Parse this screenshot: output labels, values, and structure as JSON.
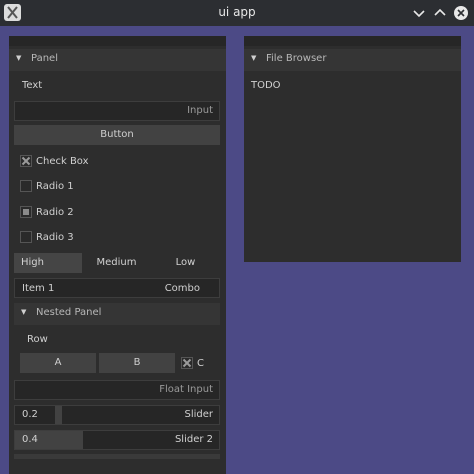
{
  "window": {
    "title": "ui app",
    "icon": "x-app-icon"
  },
  "window_controls": [
    "minimize",
    "maximize",
    "close"
  ],
  "panel": {
    "title": "Panel",
    "text": "Text",
    "input": {
      "value": "",
      "placeholder": "Input"
    },
    "button_label": "Button",
    "checkbox": {
      "label": "Check Box",
      "checked": true
    },
    "radios": [
      {
        "label": "Radio 1",
        "selected": false
      },
      {
        "label": "Radio 2",
        "selected": true
      },
      {
        "label": "Radio 3",
        "selected": false
      }
    ],
    "segmented": {
      "options": [
        "High",
        "Medium",
        "Low"
      ],
      "selected": "High"
    },
    "combo": {
      "selected": "Item 1",
      "label": "Combo"
    },
    "nested_panel": {
      "title": "Nested Panel",
      "row_label": "Row",
      "buttons": [
        "A",
        "B"
      ],
      "checkbox": {
        "label": "C",
        "checked": true
      }
    },
    "float_input": {
      "placeholder": "Float Input"
    },
    "slider1": {
      "value": "0.2",
      "label": "Slider",
      "fraction": 0.2
    },
    "slider2": {
      "value": "0.4",
      "label": "Slider 2",
      "fraction": 0.4
    }
  },
  "file_browser": {
    "title": "File Browser",
    "content": "TODO"
  },
  "colors": {
    "background": "#4c4a86",
    "panel": "#2d2d2d",
    "header": "#353535"
  }
}
